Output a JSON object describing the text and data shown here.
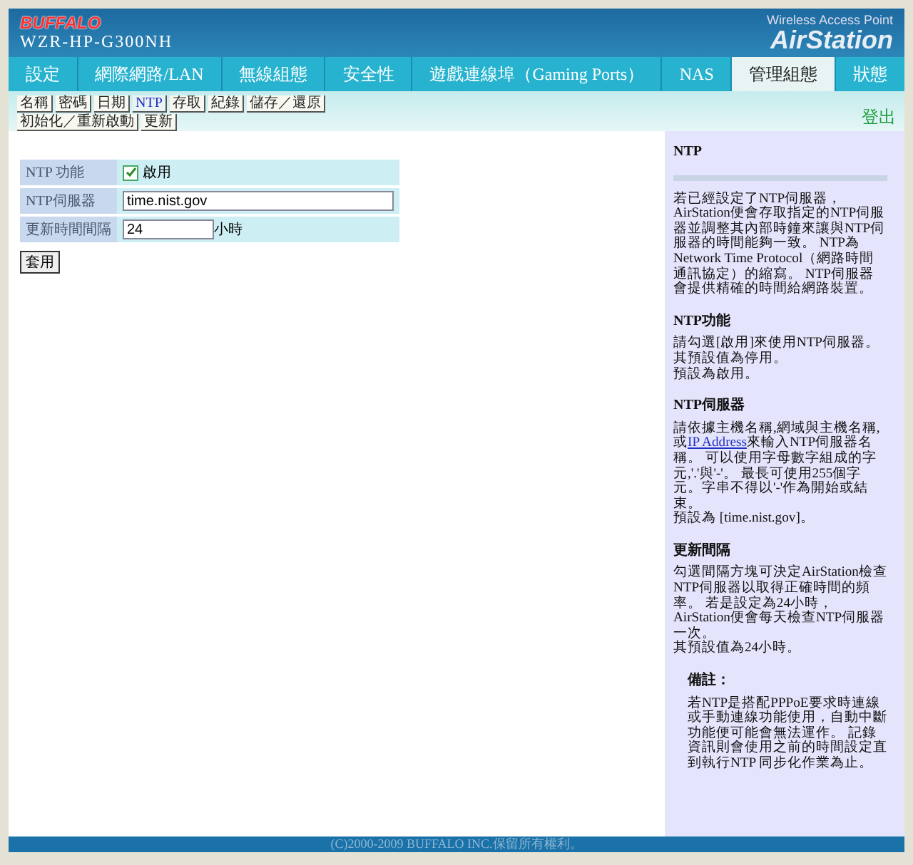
{
  "header": {
    "brand": "BUFFALO",
    "model": "WZR-HP-G300NH",
    "tagline": "Wireless Access Point",
    "product": "AirStation"
  },
  "nav": [
    {
      "label": "設定",
      "selected": false
    },
    {
      "label": "網際網路/LAN",
      "selected": false
    },
    {
      "label": "無線組態",
      "selected": false
    },
    {
      "label": "安全性",
      "selected": false
    },
    {
      "label": "遊戲連線埠（Gaming Ports）",
      "selected": false
    },
    {
      "label": "NAS",
      "selected": false
    },
    {
      "label": "管理組態",
      "selected": true
    },
    {
      "label": "狀態",
      "selected": false
    }
  ],
  "subnav": [
    [
      {
        "label": "名稱",
        "selected": false
      },
      {
        "label": "密碼",
        "selected": false
      },
      {
        "label": "日期",
        "selected": false
      },
      {
        "label": "NTP",
        "selected": true
      },
      {
        "label": "存取",
        "selected": false
      },
      {
        "label": "紀錄",
        "selected": false
      },
      {
        "label": "儲存／還原",
        "selected": false
      }
    ],
    [
      {
        "label": "初始化／重新啟動",
        "selected": false
      },
      {
        "label": "更新",
        "selected": false
      }
    ]
  ],
  "logout": "登出",
  "form": {
    "rows": [
      {
        "label": "NTP 功能",
        "kind": "checkbox",
        "checked": true,
        "text": "啟用"
      },
      {
        "label": "NTP伺服器",
        "kind": "text",
        "value": "time.nist.gov"
      },
      {
        "label": "更新時間間隔",
        "kind": "number",
        "value": "24",
        "unit": "小時"
      }
    ],
    "apply": "套用"
  },
  "help": {
    "title": "NTP",
    "sections": [
      {
        "paragraphs": [
          [
            {
              "text": "若已經設定了NTP伺服器，AirStation便會存取指定的NTP伺服器並調整其內部時鐘來讓與NTP伺服器的時間能夠一致。 NTP為Network Time Protocol（網路時間通訊協定）的縮寫。 NTP伺服器會提供精確的時間給網路裝置。"
            }
          ]
        ]
      },
      {
        "heading": "NTP功能",
        "paragraphs": [
          [
            {
              "text": "請勾選[啟用]來使用NTP伺服器。"
            }
          ],
          [
            {
              "text": "其預設值為停用。"
            }
          ],
          [
            {
              "text": "預設為啟用。"
            }
          ]
        ]
      },
      {
        "heading": "NTP伺服器",
        "paragraphs": [
          [
            {
              "text": "請依據主機名稱,網域與主機名稱,或"
            },
            {
              "text": "IP Address",
              "link": true
            },
            {
              "text": "來輸入NTP伺服器名稱。 可以使用字母數字組成的字元,'.'與'-'。 最長可使用255個字元。字串不得以'-'作為開始或結束。"
            }
          ],
          [
            {
              "text": "預設為 [time.nist.gov]。"
            }
          ]
        ]
      },
      {
        "heading": "更新間隔",
        "paragraphs": [
          [
            {
              "text": "勾選間隔方塊可決定AirStation檢查NTP伺服器以取得正確時間的頻率。 若是設定為24小時，AirStation便會每天檢查NTP伺服器一次。"
            }
          ],
          [
            {
              "text": "其預設值為24小時。"
            }
          ]
        ]
      }
    ],
    "note": {
      "heading": "備註：",
      "text": "若NTP是搭配PPPoE要求時連線或手動連線功能使用，自動中斷功能便可能會無法運作。 記錄資訊則會使用之前的時間設定直到執行NTP 同步化作業為止。"
    }
  },
  "footer": "(C)2000-2009 BUFFALO INC.保留所有權利。"
}
